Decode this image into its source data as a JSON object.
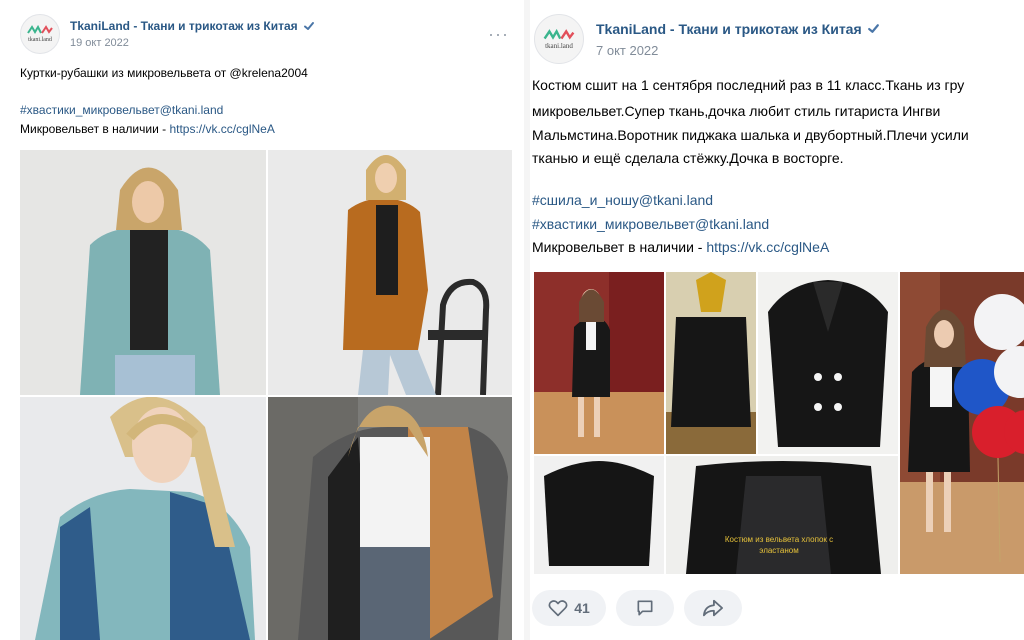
{
  "left_post": {
    "author": "TkaniLand - Ткани и трикотаж из Китая",
    "avatar_text": "tkani.land",
    "date": "19 окт 2022",
    "more_icon": "more-horizontal-icon",
    "text_line1": "Куртки-рубашки из микровельвета от @krelena2004",
    "hashtag": "#хвастики_микровельвет@tkani.land",
    "stock_text": "Микровельвет в наличии - ",
    "stock_link": "https://vk.cc/cglNeA"
  },
  "right_post": {
    "author": "TkaniLand - Ткани и трикотаж из Китая",
    "avatar_text": "tkani.land",
    "date": "7 окт 2022",
    "body_lines": [
      "Костюм сшит на 1 сентября последний раз в 11 класс.Ткань из гру",
      "микровельвет.Супер ткань,дочка любит стиль гитариста Ингви",
      "Мальмстина.Воротник пиджака шалька и двубортный.Плечи усили",
      "тканью и ещё сделала стёжку.Дочка в восторге."
    ],
    "hashtag1": "#сшила_и_ношу@tkani.land",
    "hashtag2": "#хвастики_микровельвет@tkani.land",
    "stock_text": "Микровельвет в наличии - ",
    "stock_link": "https://vk.cc/cglNeA",
    "photo_caption": "Костюм из вельвета хлопок с эластаном",
    "likes": "41",
    "like_icon": "heart-icon",
    "comment_icon": "comment-icon",
    "share_icon": "share-arrow-icon"
  },
  "colors": {
    "link": "#2a5885",
    "meta": "#818c99",
    "verified": "#4a76a8",
    "button_bg": "#f0f2f5"
  }
}
